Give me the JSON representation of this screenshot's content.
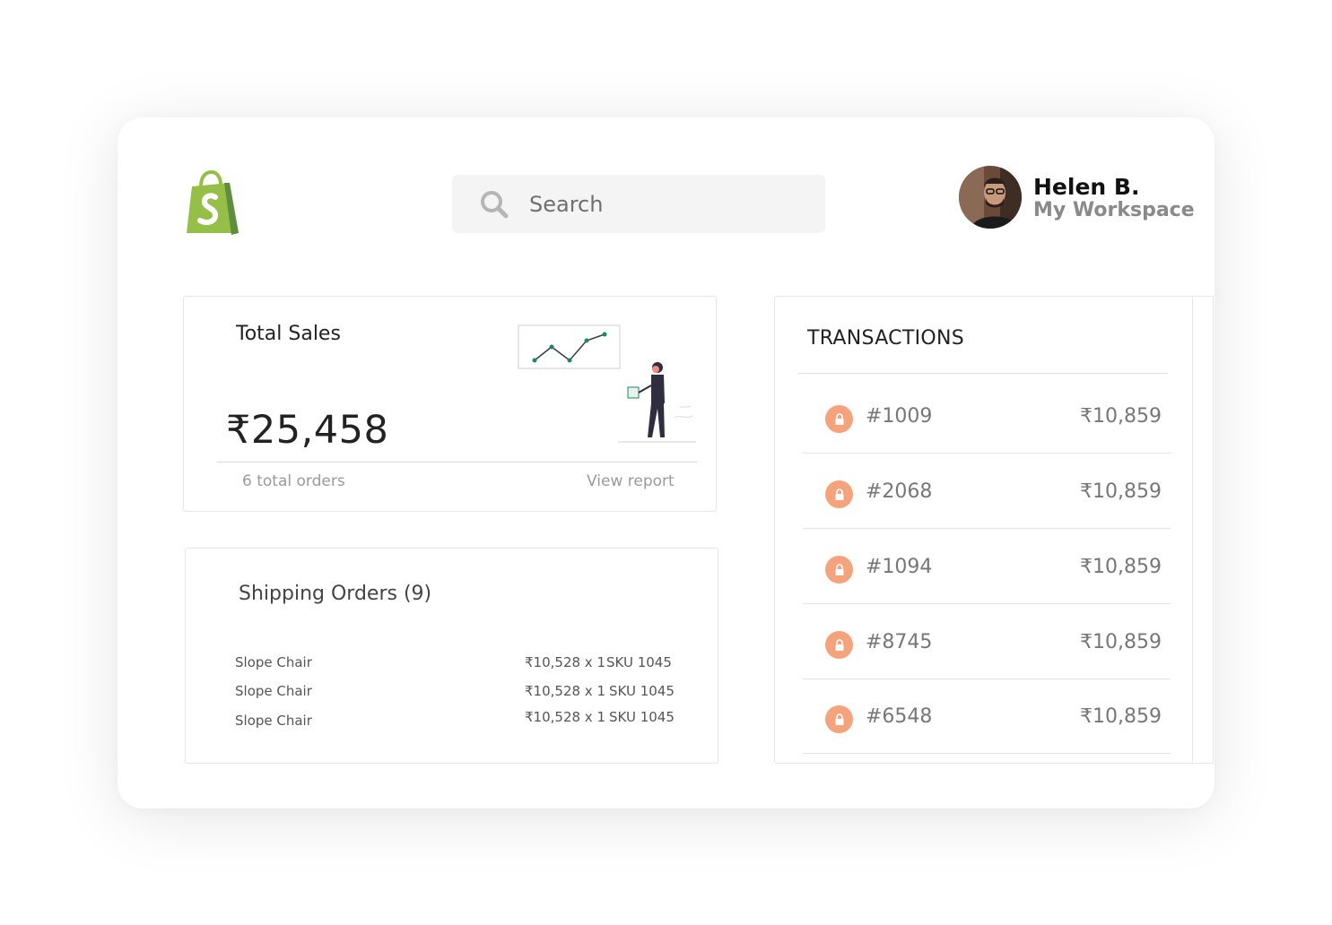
{
  "header": {
    "search_placeholder": "Search",
    "user_name": "Helen B.",
    "workspace": "My Workspace"
  },
  "colors": {
    "brand_green": "#95bf47",
    "brand_green_dark": "#5e8e3e",
    "lock_orange": "#f5a37c",
    "chart_green": "#1a8a5c"
  },
  "sales": {
    "title": "Total Sales",
    "amount": "₹25,458",
    "orders": "6 total orders",
    "report_link": "View report"
  },
  "shipping": {
    "title": "Shipping Orders (9)",
    "items": [
      {
        "name": "Slope Chair",
        "price": "₹10,528 x 1",
        "sku": "SKU 1045"
      },
      {
        "name": "Slope Chair",
        "price": "₹10,528 x 1",
        "sku": "SKU 1045"
      },
      {
        "name": "Slope Chair",
        "price": "₹10,528 x 1",
        "sku": "SKU 1045"
      }
    ]
  },
  "transactions": {
    "title": "TRANSACTIONS",
    "items": [
      {
        "id": "#1009",
        "amount": "₹10,859"
      },
      {
        "id": "#2068",
        "amount": "₹10,859"
      },
      {
        "id": "#1094",
        "amount": "₹10,859"
      },
      {
        "id": "#8745",
        "amount": "₹10,859"
      },
      {
        "id": "#6548",
        "amount": "₹10,859"
      }
    ]
  }
}
